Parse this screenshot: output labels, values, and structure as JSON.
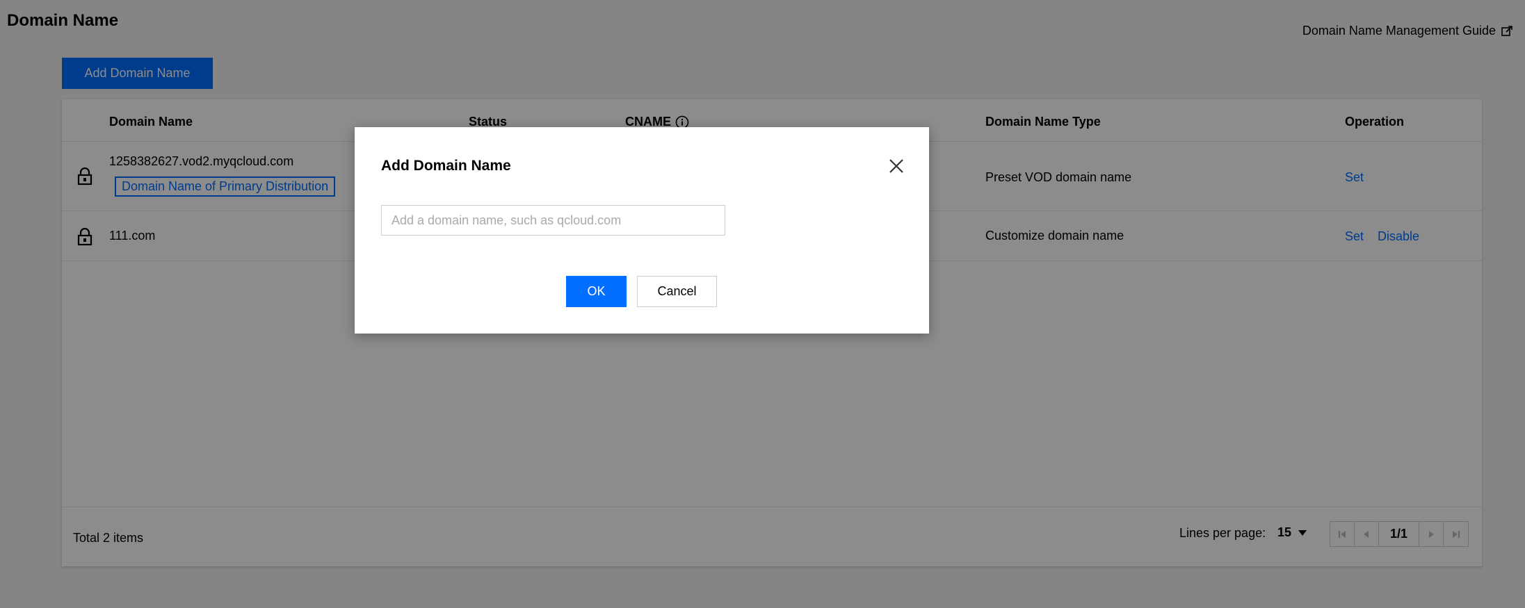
{
  "page": {
    "title": "Domain Name",
    "guide_link": "Domain Name Management Guide",
    "add_button": "Add Domain Name"
  },
  "table": {
    "columns": {
      "domain_name": "Domain Name",
      "status": "Status",
      "cname": "CNAME",
      "domain_name_type": "Domain Name Type",
      "operation": "Operation"
    },
    "rows": [
      {
        "domain": "1258382627.vod2.myqcloud.com",
        "tag": "Domain Name of Primary Distribution",
        "type": "Preset VOD domain name",
        "ops": [
          "Set"
        ]
      },
      {
        "domain": "111.com",
        "type": "Customize domain name",
        "ops": [
          "Set",
          "Disable"
        ]
      }
    ]
  },
  "footer": {
    "total": "Total 2 items",
    "lines_per_page_label": "Lines per page:",
    "lines_per_page_value": "15",
    "page_indicator": "1/1"
  },
  "dialog": {
    "title": "Add Domain Name",
    "input_placeholder": "Add a domain name, such as qcloud.com",
    "input_value": "",
    "ok_label": "OK",
    "cancel_label": "Cancel"
  },
  "colors": {
    "accent": "#006eff",
    "overlay": "rgba(0,0,0,0.45)"
  }
}
